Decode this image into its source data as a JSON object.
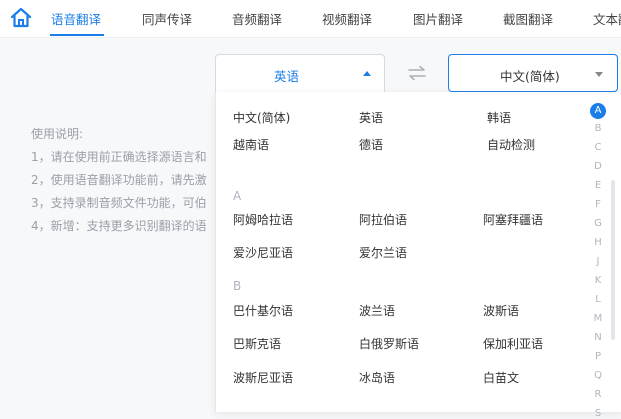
{
  "nav": {
    "tabs": [
      {
        "label": "语音翻译",
        "active": true
      },
      {
        "label": "同声传译"
      },
      {
        "label": "音频翻译"
      },
      {
        "label": "视频翻译"
      },
      {
        "label": "图片翻译"
      },
      {
        "label": "截图翻译"
      },
      {
        "label": "文本翻"
      }
    ]
  },
  "source_lang": {
    "label": "英语"
  },
  "target_lang": {
    "label": "中文(简体)"
  },
  "instructions": {
    "title": "使用说明:",
    "lines": [
      "1，请在使用前正确选择源语言和",
      "2，使用语音翻译功能前，请先激",
      "3，支持录制音频文件功能，可伯",
      "4，新增：支持更多识别翻译的语"
    ]
  },
  "dropdown": {
    "common": [
      "中文(简体)",
      "英语",
      "韩语",
      "越南语",
      "德语",
      "自动检测"
    ],
    "groups": [
      {
        "letter": "A",
        "items": [
          "阿姆哈拉语",
          "阿拉伯语",
          "阿塞拜疆语",
          "爱沙尼亚语",
          "爱尔兰语"
        ]
      },
      {
        "letter": "B",
        "items": [
          "巴什基尔语",
          "波兰语",
          "波斯语",
          "巴斯克语",
          "白俄罗斯语",
          "保加利亚语",
          "波斯尼亚语",
          "冰岛语",
          "白苗文"
        ]
      }
    ],
    "alphabet": [
      "A",
      "B",
      "C",
      "D",
      "E",
      "F",
      "G",
      "H",
      "J",
      "K",
      "L",
      "M",
      "N",
      "P",
      "Q",
      "R",
      "S"
    ],
    "active_letter": "A"
  },
  "colors": {
    "accent": "#1b7ee8",
    "muted": "#9aa0a8"
  }
}
